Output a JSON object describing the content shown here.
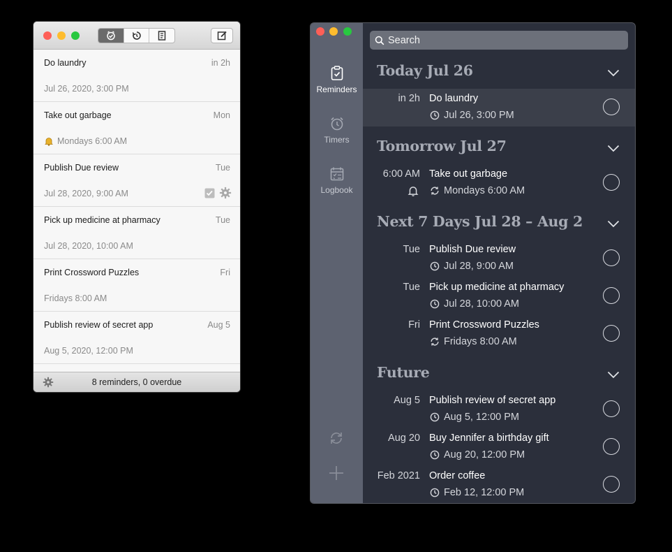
{
  "light_window": {
    "toolbar": {
      "tabs": [
        "reminders-icon",
        "timers-icon",
        "logbook-icon"
      ],
      "active_tab": 0
    },
    "rows": [
      {
        "title": "Do laundry",
        "when": "in 2h",
        "sub": "Jul 26, 2020, 3:00 PM",
        "icon": ""
      },
      {
        "title": "Take out garbage",
        "when": "Mon",
        "sub": "Mondays 6:00 AM",
        "icon": "bell-icon"
      },
      {
        "title": "Publish Due review",
        "when": "Tue",
        "sub": "Jul 28, 2020, 9:00 AM",
        "icon": "",
        "actions": true
      },
      {
        "title": "Pick up medicine at pharmacy",
        "when": "Tue",
        "sub": "Jul 28, 2020, 10:00 AM",
        "icon": ""
      },
      {
        "title": "Print Crossword Puzzles",
        "when": "Fri",
        "sub": "Fridays 8:00 AM",
        "icon": ""
      },
      {
        "title": "Publish review of secret app",
        "when": "Aug 5",
        "sub": "Aug 5, 2020, 12:00 PM",
        "icon": ""
      }
    ],
    "footer": {
      "status": "8 reminders, 0 overdue"
    }
  },
  "dark_window": {
    "sidebar": [
      {
        "label": "Reminders",
        "icon": "reminders-icon",
        "active": true
      },
      {
        "label": "Timers",
        "icon": "alarm-clock-icon",
        "active": false
      },
      {
        "label": "Logbook",
        "icon": "logbook-icon",
        "active": false
      }
    ],
    "search": {
      "placeholder": "Search"
    },
    "sections": [
      {
        "title": "Today Jul 26",
        "items": [
          {
            "when": "in 2h",
            "title": "Do laundry",
            "sub": "Jul 26, 3:00 PM",
            "sub_icon": "clock-icon",
            "bell": false,
            "selected": true
          }
        ]
      },
      {
        "title": "Tomorrow Jul 27",
        "items": [
          {
            "when": "6:00 AM",
            "title": "Take out garbage",
            "sub": "Mondays 6:00 AM",
            "sub_icon": "repeat-icon",
            "bell": true,
            "selected": false
          }
        ]
      },
      {
        "title": "Next 7 Days Jul 28 – Aug 2",
        "items": [
          {
            "when": "Tue",
            "title": "Publish Due review",
            "sub": "Jul 28, 9:00 AM",
            "sub_icon": "clock-icon",
            "bell": false,
            "selected": false
          },
          {
            "when": "Tue",
            "title": "Pick up medicine at pharmacy",
            "sub": "Jul 28, 10:00 AM",
            "sub_icon": "clock-icon",
            "bell": false,
            "selected": false
          },
          {
            "when": "Fri",
            "title": "Print Crossword Puzzles",
            "sub": "Fridays 8:00 AM",
            "sub_icon": "repeat-icon",
            "bell": false,
            "selected": false
          }
        ]
      },
      {
        "title": "Future",
        "items": [
          {
            "when": "Aug 5",
            "title": "Publish review of secret app",
            "sub": "Aug 5, 12:00 PM",
            "sub_icon": "clock-icon",
            "bell": false,
            "selected": false
          },
          {
            "when": "Aug 20",
            "title": "Buy Jennifer a birthday gift",
            "sub": "Aug 20, 12:00 PM",
            "sub_icon": "clock-icon",
            "bell": false,
            "selected": false
          },
          {
            "when": "Feb 2021",
            "title": "Order coffee",
            "sub": "Feb 12, 12:00 PM",
            "sub_icon": "clock-icon",
            "bell": false,
            "selected": false
          }
        ]
      }
    ]
  }
}
